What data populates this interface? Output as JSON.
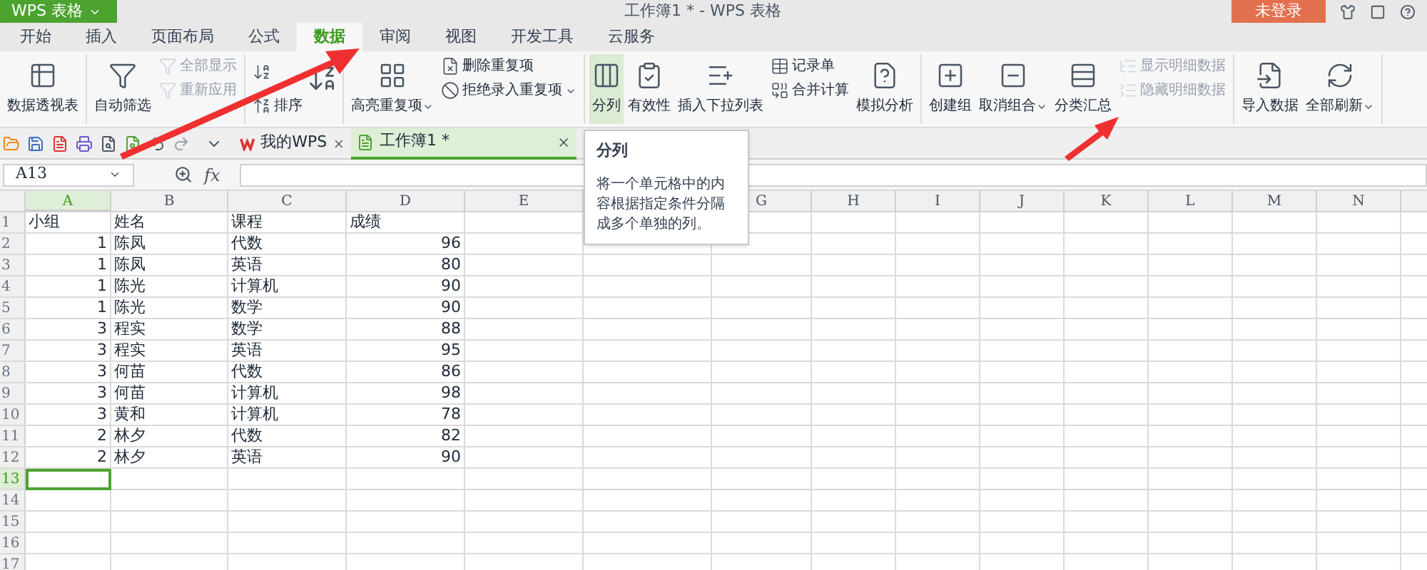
{
  "title_bar": {
    "app_button": "WPS 表格",
    "title": "工作簿1 * - WPS 表格",
    "login_button": "未登录"
  },
  "tabs": [
    {
      "label": "开始",
      "selected": false
    },
    {
      "label": "插入",
      "selected": false
    },
    {
      "label": "页面布局",
      "selected": false
    },
    {
      "label": "公式",
      "selected": false
    },
    {
      "label": "数据",
      "selected": true
    },
    {
      "label": "审阅",
      "selected": false
    },
    {
      "label": "视图",
      "selected": false
    },
    {
      "label": "开发工具",
      "selected": false
    },
    {
      "label": "云服务",
      "selected": false
    }
  ],
  "ribbon": {
    "groups": [
      {
        "items": [
          {
            "kind": "large",
            "label": "数据透视表",
            "selected": false
          }
        ]
      },
      {
        "items": [
          {
            "kind": "large",
            "label": "自动筛选",
            "selected": false
          },
          {
            "kind": "stack",
            "items": [
              {
                "label": "全部显示",
                "disabled": true
              },
              {
                "label": "重新应用",
                "disabled": true
              }
            ]
          }
        ]
      },
      {
        "items": [
          {
            "kind": "stack",
            "items": [
              {
                "disabled": false
              },
              {
                "label": "排序",
                "disabled": false
              }
            ]
          },
          {
            "kind": "icon"
          }
        ]
      },
      {
        "items": [
          {
            "kind": "large",
            "label": "高亮重复项",
            "dropdown": true,
            "selected": false
          },
          {
            "kind": "stack",
            "items": [
              {
                "label": "删除重复项",
                "disabled": false
              },
              {
                "label": "拒绝录入重复项",
                "dropdown": true,
                "disabled": false
              }
            ]
          }
        ]
      },
      {
        "items": [
          {
            "kind": "large",
            "label": "分列",
            "selected": true
          },
          {
            "kind": "large",
            "label": "有效性",
            "selected": false
          },
          {
            "kind": "large",
            "label": "插入下拉列表",
            "selected": false
          },
          {
            "kind": "stack",
            "items": [
              {
                "label": "记录单",
                "disabled": false
              },
              {
                "label": "合并计算",
                "disabled": false
              }
            ]
          },
          {
            "kind": "large",
            "label": "模拟分析",
            "selected": false
          }
        ]
      },
      {
        "items": [
          {
            "kind": "large",
            "label": "创建组",
            "selected": false
          },
          {
            "kind": "large",
            "label": "取消组合",
            "dropdown": true,
            "selected": false
          },
          {
            "kind": "large",
            "label": "分类汇总",
            "selected": false
          },
          {
            "kind": "stack",
            "items": [
              {
                "label": "显示明细数据",
                "disabled": true
              },
              {
                "label": "隐藏明细数据",
                "disabled": true
              }
            ]
          }
        ]
      },
      {
        "items": [
          {
            "kind": "large",
            "label": "导入数据",
            "selected": false
          },
          {
            "kind": "large",
            "label": "全部刷新",
            "dropdown": true,
            "selected": false
          }
        ]
      }
    ]
  },
  "doc_tabs": [
    {
      "label": "我的WPS",
      "selected": false
    },
    {
      "label": "工作簿1 *",
      "selected": true
    }
  ],
  "formula_bar": {
    "name_box": "A13",
    "fx_label": "fx"
  },
  "tooltip": {
    "title": "分列",
    "body": "将一个单元格中的内容根据指定条件分隔成多个单独的列。"
  },
  "sheet": {
    "columns": [
      {
        "label": "A",
        "selected": true
      },
      {
        "label": "B",
        "selected": false
      },
      {
        "label": "C",
        "selected": false
      },
      {
        "label": "D",
        "selected": false
      },
      {
        "label": "E",
        "selected": false
      },
      {},
      {
        "label": "G",
        "selected": false
      },
      {
        "label": "H",
        "selected": false
      },
      {
        "label": "I",
        "selected": false
      },
      {
        "label": "J",
        "selected": false
      },
      {
        "label": "K",
        "selected": false
      },
      {
        "label": "L",
        "selected": false
      },
      {
        "label": "M",
        "selected": false
      },
      {
        "label": "N",
        "selected": false
      }
    ],
    "rows": [
      {
        "label": "1",
        "selected": false,
        "cells": [
          {
            "text": "小组",
            "kind": "text"
          },
          {
            "text": "姓名",
            "kind": "text"
          },
          {
            "text": "课程",
            "kind": "text"
          },
          {
            "text": "成绩",
            "kind": "text"
          }
        ]
      },
      {
        "label": "2",
        "selected": false,
        "cells": [
          {
            "text": "1",
            "kind": "number"
          },
          {
            "text": "陈凤",
            "kind": "text"
          },
          {
            "text": "代数",
            "kind": "text"
          },
          {
            "text": "96",
            "kind": "number"
          }
        ]
      },
      {
        "label": "3",
        "selected": false,
        "cells": [
          {
            "text": "1",
            "kind": "number"
          },
          {
            "text": "陈凤",
            "kind": "text"
          },
          {
            "text": "英语",
            "kind": "text"
          },
          {
            "text": "80",
            "kind": "number"
          }
        ]
      },
      {
        "label": "4",
        "selected": false,
        "cells": [
          {
            "text": "1",
            "kind": "number"
          },
          {
            "text": "陈光",
            "kind": "text"
          },
          {
            "text": "计算机",
            "kind": "text"
          },
          {
            "text": "90",
            "kind": "number"
          }
        ]
      },
      {
        "label": "5",
        "selected": false,
        "cells": [
          {
            "text": "1",
            "kind": "number"
          },
          {
            "text": "陈光",
            "kind": "text"
          },
          {
            "text": "数学",
            "kind": "text"
          },
          {
            "text": "90",
            "kind": "number"
          }
        ]
      },
      {
        "label": "6",
        "selected": false,
        "cells": [
          {
            "text": "3",
            "kind": "number"
          },
          {
            "text": "程实",
            "kind": "text"
          },
          {
            "text": "数学",
            "kind": "text"
          },
          {
            "text": "88",
            "kind": "number"
          }
        ]
      },
      {
        "label": "7",
        "selected": false,
        "cells": [
          {
            "text": "3",
            "kind": "number"
          },
          {
            "text": "程实",
            "kind": "text"
          },
          {
            "text": "英语",
            "kind": "text"
          },
          {
            "text": "95",
            "kind": "number"
          }
        ]
      },
      {
        "label": "8",
        "selected": false,
        "cells": [
          {
            "text": "3",
            "kind": "number"
          },
          {
            "text": "何苗",
            "kind": "text"
          },
          {
            "text": "代数",
            "kind": "text"
          },
          {
            "text": "86",
            "kind": "number"
          }
        ]
      },
      {
        "label": "9",
        "selected": false,
        "cells": [
          {
            "text": "3",
            "kind": "number"
          },
          {
            "text": "何苗",
            "kind": "text"
          },
          {
            "text": "计算机",
            "kind": "text"
          },
          {
            "text": "98",
            "kind": "number"
          }
        ]
      },
      {
        "label": "10",
        "selected": false,
        "cells": [
          {
            "text": "3",
            "kind": "number"
          },
          {
            "text": "黄和",
            "kind": "text"
          },
          {
            "text": "计算机",
            "kind": "text"
          },
          {
            "text": "78",
            "kind": "number"
          }
        ]
      },
      {
        "label": "11",
        "selected": false,
        "cells": [
          {
            "text": "2",
            "kind": "number"
          },
          {
            "text": "林夕",
            "kind": "text"
          },
          {
            "text": "代数",
            "kind": "text"
          },
          {
            "text": "82",
            "kind": "number"
          }
        ]
      },
      {
        "label": "12",
        "selected": false,
        "cells": [
          {
            "text": "2",
            "kind": "number"
          },
          {
            "text": "林夕",
            "kind": "text"
          },
          {
            "text": "英语",
            "kind": "text"
          },
          {
            "text": "90",
            "kind": "number"
          }
        ]
      },
      {
        "label": "13",
        "selected": true
      },
      {
        "label": "14",
        "selected": false
      },
      {
        "label": "15",
        "selected": false
      },
      {
        "label": "16",
        "selected": false
      },
      {
        "label": "17",
        "selected": false
      }
    ]
  }
}
